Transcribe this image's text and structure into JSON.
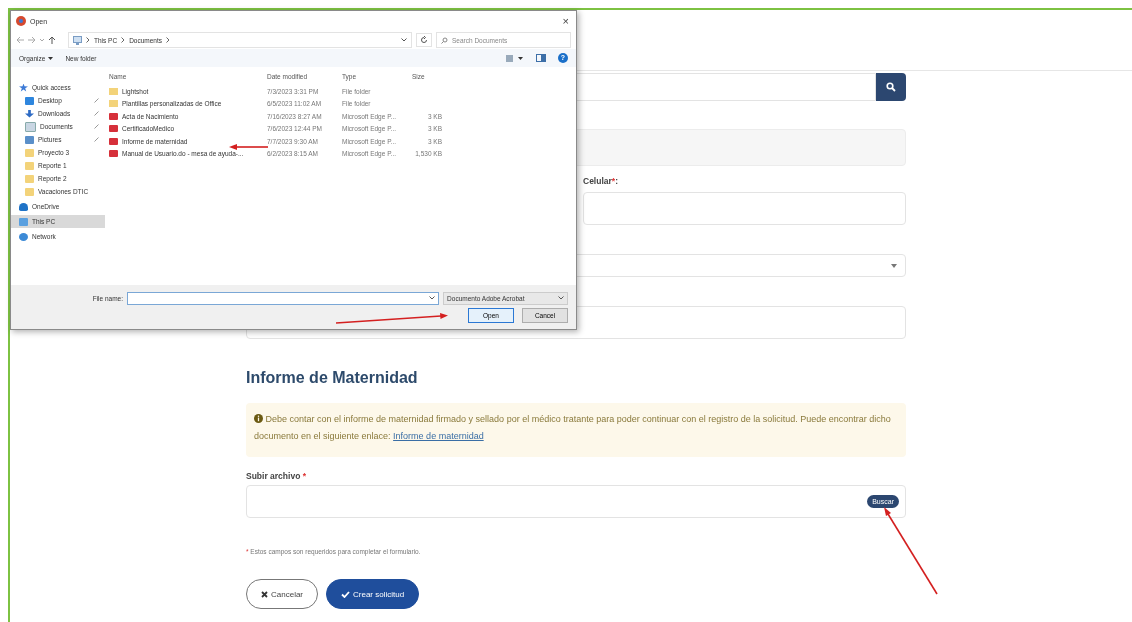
{
  "dialog": {
    "title": "Open",
    "close": "×",
    "path": [
      {
        "label": "This PC"
      },
      {
        "label": "Documents"
      }
    ],
    "search": {
      "placeholder": "Search Documents"
    },
    "toolbar": [
      {
        "label": "Organize",
        "kind": "menu"
      },
      {
        "label": "New folder",
        "kind": "plain"
      }
    ],
    "help": "?",
    "nav": [
      {
        "label": "Quick access",
        "selected": false,
        "children": [
          {
            "label": "Desktop",
            "pinned": true,
            "selected": false
          },
          {
            "label": "Downloads",
            "pinned": true,
            "selected": false
          },
          {
            "label": "Documents",
            "pinned": true,
            "selected": false
          },
          {
            "label": "Pictures",
            "pinned": true,
            "selected": false
          },
          {
            "label": "Proyecto 3",
            "pinned": false,
            "selected": false
          },
          {
            "label": "Reporte 1",
            "pinned": false,
            "selected": false
          },
          {
            "label": "Reporte 2",
            "pinned": false,
            "selected": false
          },
          {
            "label": "Vacaciones DTIC",
            "pinned": false,
            "selected": false
          }
        ]
      },
      {
        "label": "OneDrive",
        "selected": false
      },
      {
        "label": "This PC",
        "selected": true
      },
      {
        "label": "Network",
        "selected": false
      }
    ],
    "columns": [
      "Name",
      "Date modified",
      "Type",
      "Size"
    ],
    "files": [
      {
        "name": "Lightshot",
        "date": "7/3/2023 3:31 PM",
        "type": "File folder",
        "kind": "folder"
      },
      {
        "name": "Plantillas personalizadas de Office",
        "date": "6/5/2023 11:02 AM",
        "type": "File folder",
        "kind": "folder"
      },
      {
        "name": "Acta de Nacimiento",
        "date": "7/16/2023 8:27 AM",
        "type": "Microsoft Edge P...",
        "size": "3 KB",
        "kind": "pdf"
      },
      {
        "name": "CertificadoMedico",
        "date": "7/6/2023 12:44 PM",
        "type": "Microsoft Edge P...",
        "size": "3 KB",
        "kind": "pdf"
      },
      {
        "name": "Informe de maternidad",
        "date": "7/7/2023 9:30 AM",
        "type": "Microsoft Edge P...",
        "size": "3 KB",
        "kind": "pdf"
      },
      {
        "name": "Manual de Usuario.do - mesa de ayuda-...",
        "date": "6/2/2023 8:15 AM",
        "type": "Microsoft Edge P...",
        "size": "1,530 KB",
        "kind": "pdf"
      }
    ],
    "file_name_label": "File name:",
    "file_type": "Documento Adobe Acrobat",
    "buttons": [
      {
        "label": "Open",
        "kind": "default"
      },
      {
        "label": "Cancel",
        "kind": "plain"
      }
    ]
  },
  "form": {
    "celular": {
      "label": "Celular",
      "mark": "*",
      "suffix": ":"
    },
    "section_title": "Informe de Maternidad",
    "alert": {
      "text": "Debe contar con el informe de maternidad firmado y sellado por el médico tratante para poder continuar con el registro de la solicitud. Puede encontrar dicho documento en el siguiente enlace:",
      "link": "Informe de maternidad"
    },
    "upload": {
      "label": "Subir archivo",
      "mark": "*",
      "button": "Buscar"
    },
    "note": {
      "mark": "*",
      "text": "Estos campos son requeridos para completar el formulario."
    },
    "actions": [
      {
        "label": "Cancelar",
        "kind": "cancel"
      },
      {
        "label": "Crear solicitud",
        "kind": "submit"
      }
    ]
  }
}
